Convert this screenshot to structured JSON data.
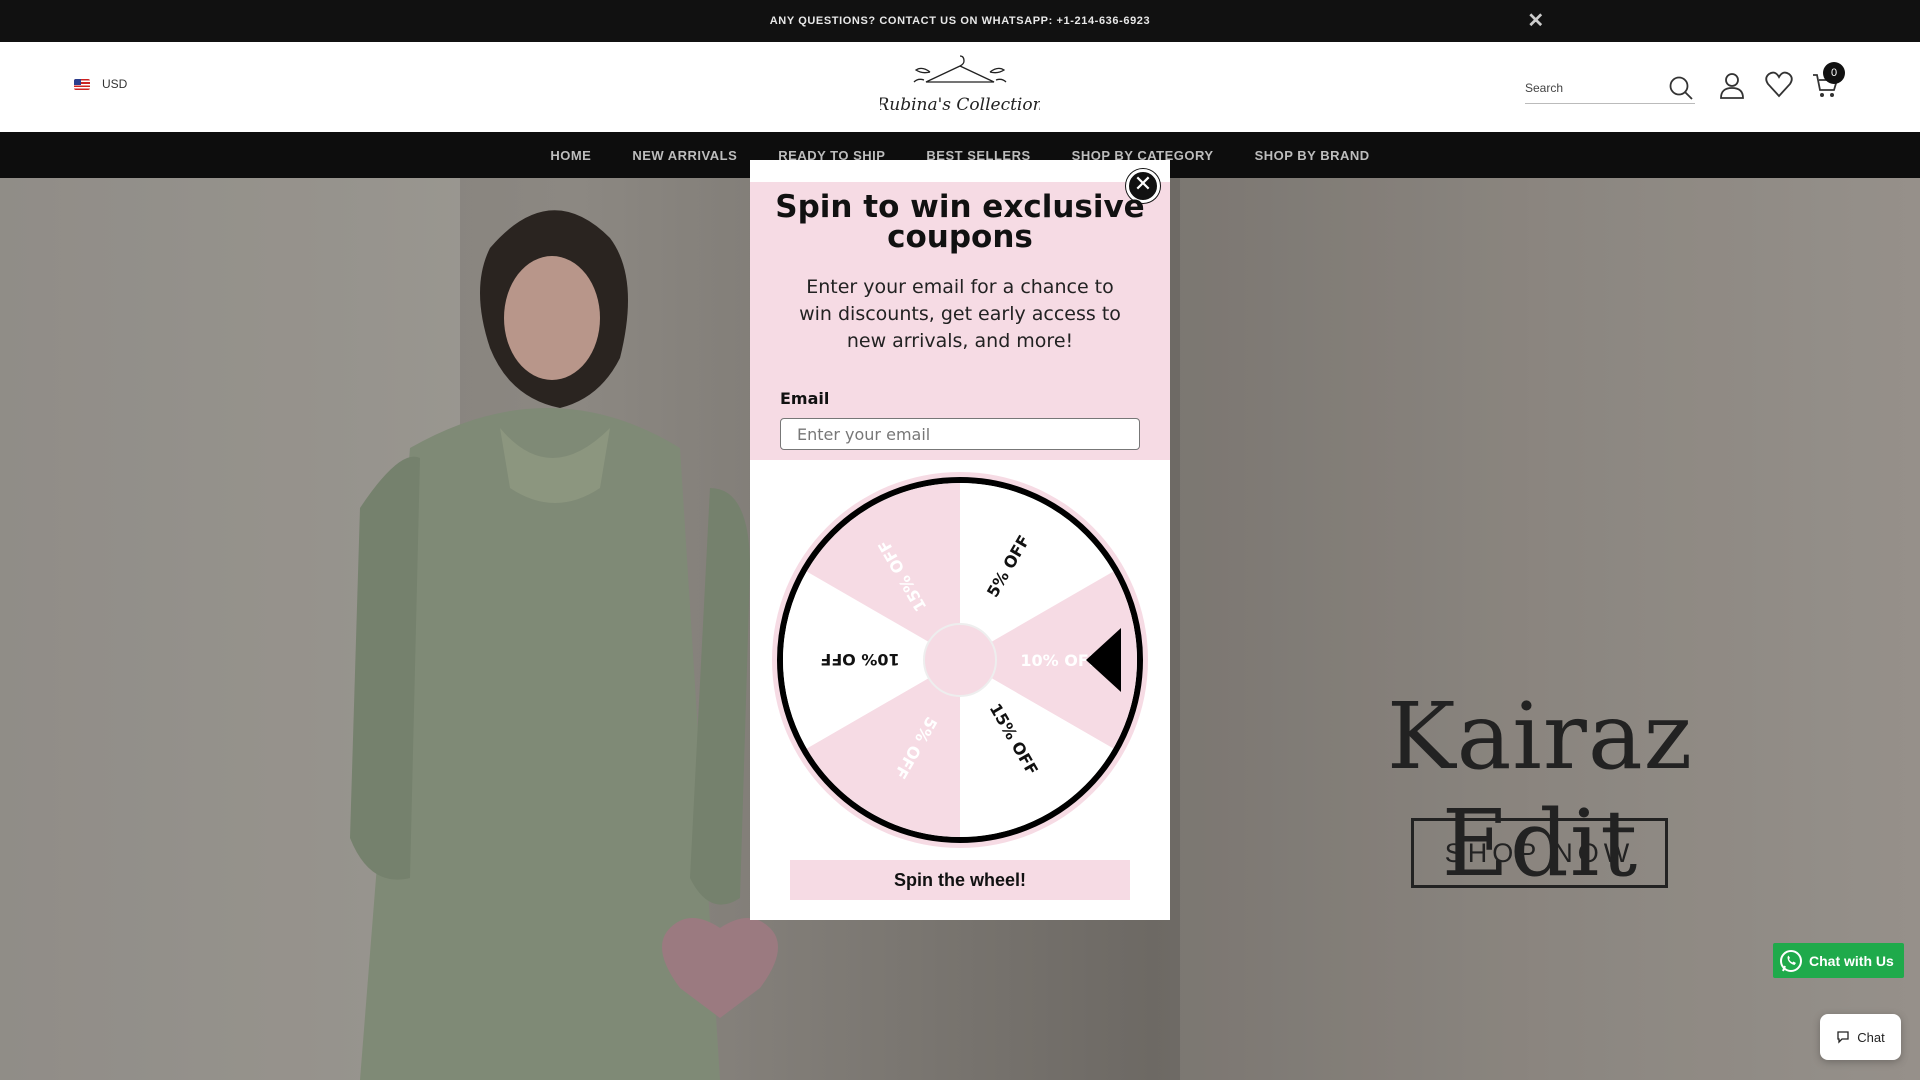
{
  "announcement": {
    "text": "ANY QUESTIONS? CONTACT US ON WHATSAPP: +1-214-636-6923",
    "close_icon": "close-icon"
  },
  "header": {
    "currency": "USD",
    "flag_icon": "us-flag-icon",
    "logo_text": "Rubina's Collection",
    "search_placeholder": "Search",
    "cart_count": "0"
  },
  "nav": {
    "items": [
      "HOME",
      "NEW ARRIVALS",
      "READY TO SHIP",
      "BEST SELLERS",
      "SHOP BY CATEGORY",
      "SHOP BY BRAND"
    ]
  },
  "hero": {
    "title": "Kairaz Edit",
    "cta": "SHOP NOW"
  },
  "popup": {
    "title": "Spin to win exclusive coupons",
    "description": "Enter your email for a chance to win discounts, get early access to new arrivals, and more!",
    "email_label": "Email",
    "email_placeholder": "Enter your email",
    "wheel_segments": [
      "5% OFF",
      "10% OFF",
      "15% OFF",
      "5% OFF",
      "10% OFF",
      "15% OFF"
    ],
    "spin_button": "Spin the wheel!",
    "accent_color": "#f6dbe4"
  },
  "widgets": {
    "whatsapp_label": "Chat with Us",
    "chat_label": "Chat"
  }
}
